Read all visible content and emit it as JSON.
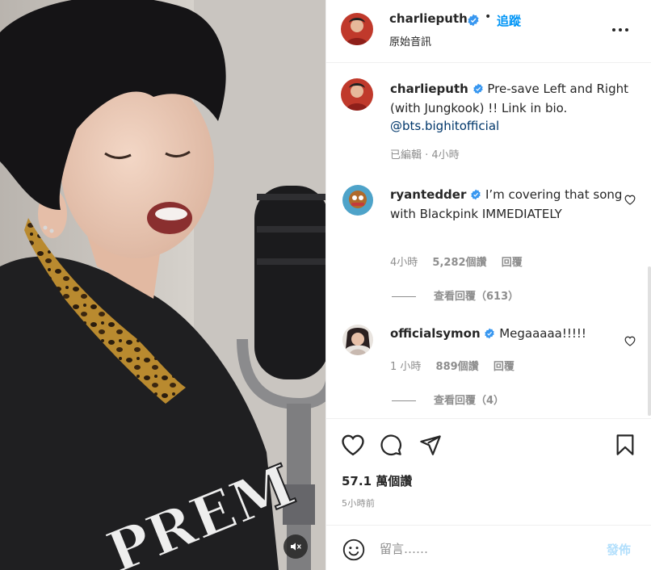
{
  "post": {
    "author": "charlieputh",
    "follow_label": "追蹤",
    "separator": "•",
    "audio_label": "原始音訊",
    "caption_text": "Pre-save Left and Right (with Jungkook) !! Link in bio.",
    "caption_mention": "@bts.bighitofficial",
    "caption_meta": "已編輯 · 4小時"
  },
  "media": {
    "hoodie_text": "PREM",
    "mute_icon": "speaker-muted-icon"
  },
  "comments": [
    {
      "user": "ryantedder",
      "text": "I’m covering that song with Blackpink IMMEDIATELY",
      "time": "4小時",
      "likes": "5,282個讚",
      "reply_label": "回覆",
      "view_replies": "查看回覆（613）"
    },
    {
      "user": "officialsymon",
      "text": "Megaaaaa!!!!!",
      "time": "1 小時",
      "likes": "889個讚",
      "reply_label": "回覆",
      "view_replies": "查看回覆（4）"
    }
  ],
  "stats": {
    "likes": "57.1 萬個讚",
    "time_ago": "5小時前"
  },
  "composer": {
    "placeholder": "留言……",
    "post_label": "發佈"
  },
  "colors": {
    "link_blue": "#0095f6",
    "mention": "#00376b",
    "verified": "#3897f0",
    "muted_text": "#8e8e8e",
    "post_disabled": "#b2dffc"
  }
}
